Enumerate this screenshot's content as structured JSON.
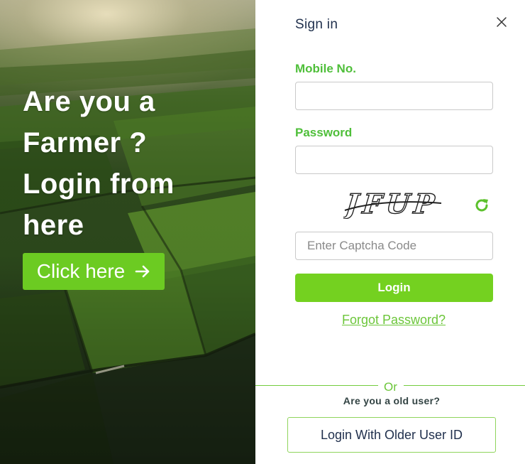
{
  "hero": {
    "title_lines": [
      "Are you a",
      "Farmer ?",
      "Login from",
      "here"
    ],
    "button_label": "Click here",
    "button_icon": "arrow-right-icon"
  },
  "signin": {
    "title": "Sign in",
    "close_icon": "close-icon",
    "mobile_label": "Mobile No.",
    "mobile_value": "",
    "password_label": "Password",
    "password_value": "",
    "captcha_text": "JFUP",
    "refresh_icon": "refresh-icon",
    "captcha_placeholder": "Enter Captcha Code",
    "login_label": "Login",
    "forgot_label": "Forgot Password?",
    "or_label": "Or",
    "old_user_question": "Are you a old user?",
    "older_login_label": "Login With Older User ID"
  },
  "colors": {
    "accent_green": "#74d120",
    "label_green": "#4fbf3a",
    "title_navy": "#1f2f4c"
  }
}
